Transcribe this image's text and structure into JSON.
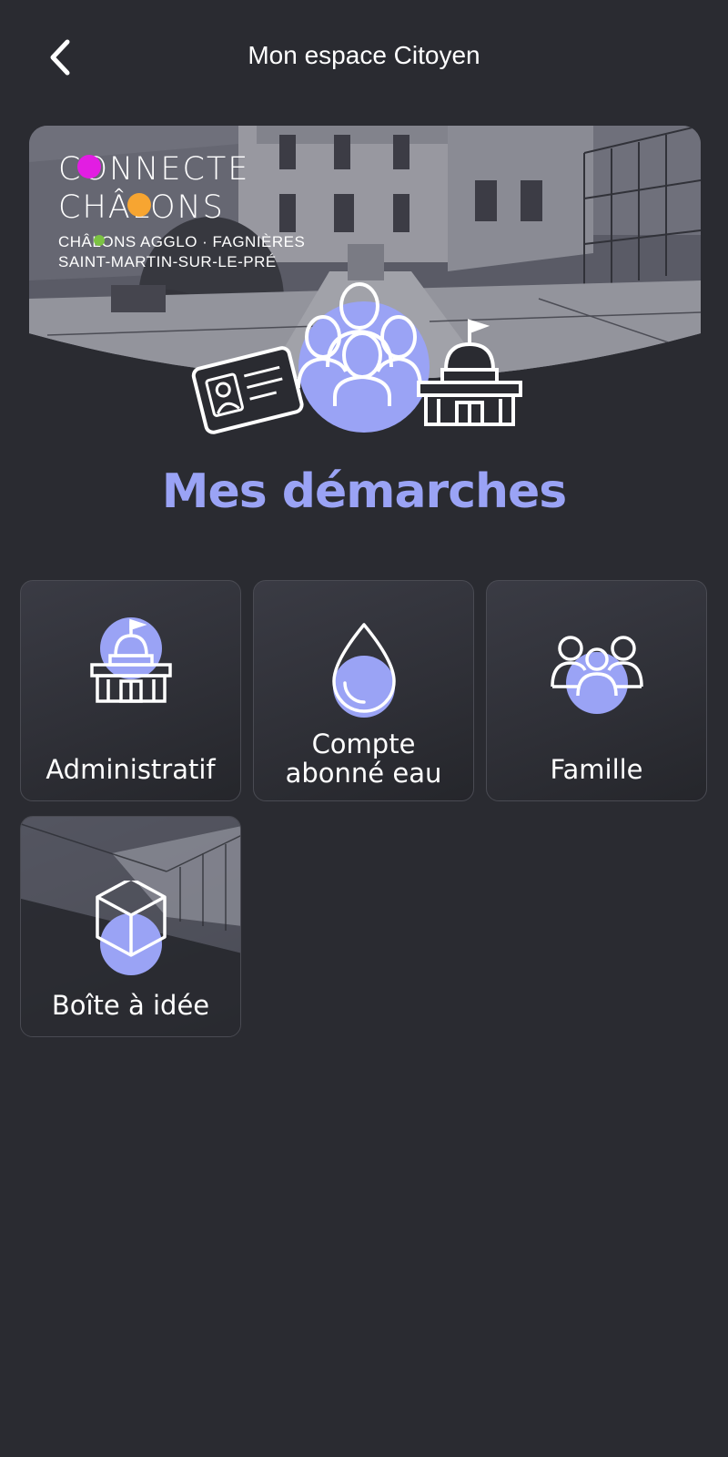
{
  "header": {
    "title": "Mon espace Citoyen"
  },
  "hero": {
    "logo_line1": "CONNECTE",
    "logo_line2": "CHÂLONS",
    "logo_sub1": "CHÂLONS AGGLO · FAGNIÈRES",
    "logo_sub2": "SAINT-MARTIN-SUR-LE-PRÉ"
  },
  "main": {
    "section_title": "Mes démarches",
    "tiles": [
      {
        "label": "Administratif",
        "icon": "city-hall-icon"
      },
      {
        "label": "Compte abonné eau",
        "icon": "water-drop-icon"
      },
      {
        "label": "Famille",
        "icon": "family-icon"
      },
      {
        "label": "Boîte à idée",
        "icon": "idea-box-icon"
      }
    ]
  },
  "colors": {
    "background": "#2a2b31",
    "accent": "#9aa3f5",
    "logo_magenta": "#e21de2",
    "logo_orange": "#f7a531",
    "logo_green": "#7cc243"
  }
}
